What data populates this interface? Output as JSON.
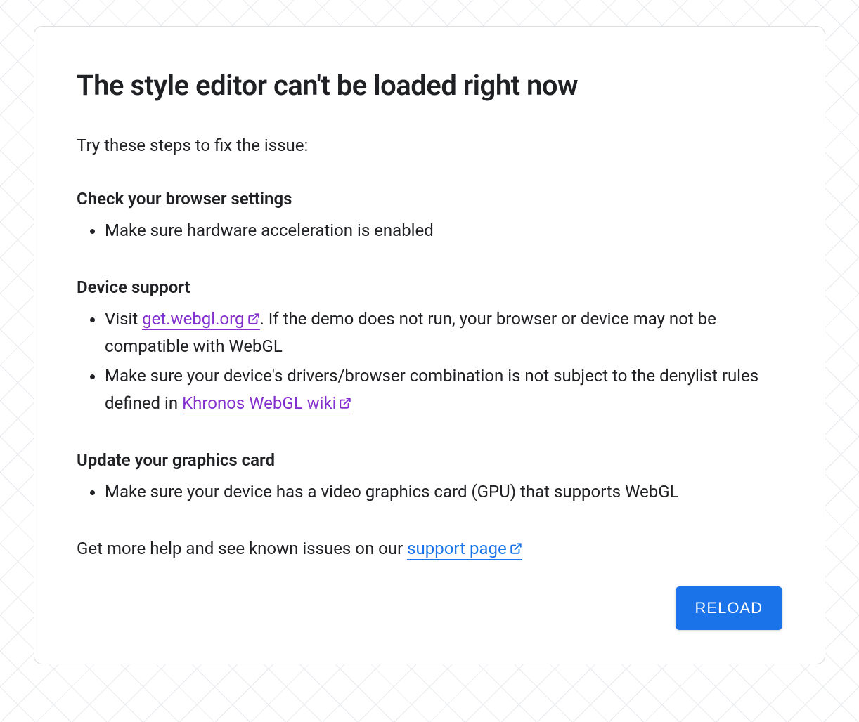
{
  "title": "The style editor can't be loaded right now",
  "intro": "Try these steps to fix the issue:",
  "sections": {
    "browser": {
      "heading": "Check your browser settings",
      "item1": "Make sure hardware acceleration is enabled"
    },
    "device": {
      "heading": "Device support",
      "item1_prefix": "Visit ",
      "item1_link": "get.webgl.org",
      "item1_suffix": ". If the demo does not run, your browser or device may not be compatible with WebGL",
      "item2_prefix": "Make sure your device's drivers/browser combination is not subject to the denylist rules defined in ",
      "item2_link": "Khronos WebGL wiki"
    },
    "graphics": {
      "heading": "Update your graphics card",
      "item1": "Make sure your device has a video graphics card (GPU) that supports WebGL"
    }
  },
  "footer": {
    "prefix": "Get more help and see known issues on our ",
    "link": "support page"
  },
  "reload_button": "RELOAD",
  "colors": {
    "link_visited": "#8430ce",
    "link_blue": "#1a73e8",
    "button_bg": "#1a73e8"
  }
}
